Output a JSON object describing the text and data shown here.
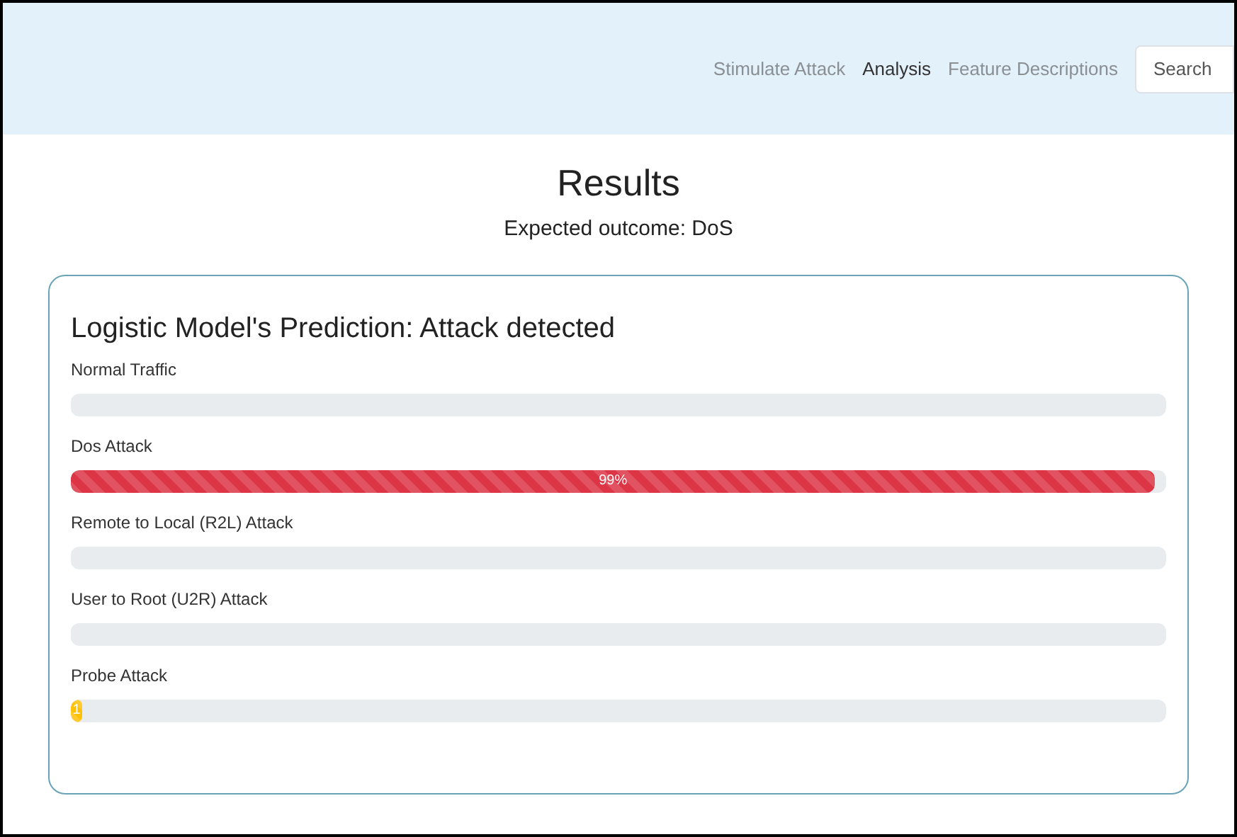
{
  "nav": {
    "links": [
      {
        "label": "Stimulate Attack",
        "selected": false
      },
      {
        "label": "Analysis",
        "selected": true
      },
      {
        "label": "Feature Descriptions",
        "selected": false
      }
    ],
    "search": {
      "placeholder": "Search"
    }
  },
  "heading": "Results",
  "expected": "Expected outcome: DoS",
  "card": {
    "title": "Logistic Model's Prediction: Attack detected",
    "bars": [
      {
        "label": "Normal Traffic"
      },
      {
        "label": "Dos Attack",
        "level": 0.99,
        "reading": "99%",
        "color": "#dc3545"
      },
      {
        "label": "Remote to Local (R2L) Attack"
      },
      {
        "label": "User to Root (U2R) Attack"
      },
      {
        "label": "Probe Attack",
        "level": 0.01,
        "reading": "1",
        "color": "#ffc107"
      }
    ]
  }
}
